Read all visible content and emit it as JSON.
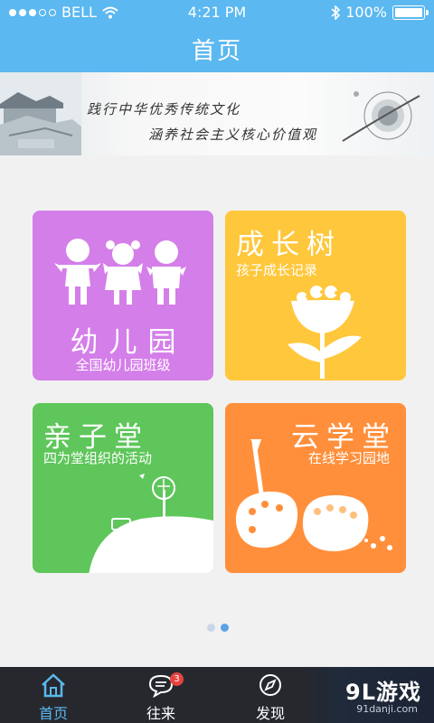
{
  "status": {
    "carrier": "BELL",
    "time": "4:21 PM",
    "battery": "100%"
  },
  "header": {
    "title": "首页"
  },
  "banner": {
    "line1": "践行中华优秀传统文化",
    "line2": "涵养社会主义核心价值观"
  },
  "tiles": [
    {
      "title": "幼儿园",
      "subtitle": "全国幼儿园班级",
      "color": "#d47ee9"
    },
    {
      "title": "成长树",
      "subtitle": "孩子成长记录",
      "color": "#ffc73b"
    },
    {
      "title": "亲子堂",
      "subtitle": "四为堂组织的活动",
      "color": "#5ec65a"
    },
    {
      "title": "云学堂",
      "subtitle": "在线学习园地",
      "color": "#ff8f3b"
    }
  ],
  "pager": {
    "pages": 2,
    "current": 2
  },
  "tabbar": {
    "items": [
      {
        "label": "首页",
        "icon": "home-icon",
        "active": true
      },
      {
        "label": "往来",
        "icon": "chat-icon",
        "badge": "3"
      },
      {
        "label": "发现",
        "icon": "compass-icon"
      }
    ]
  },
  "watermark": {
    "brand": "9L游戏",
    "domain": "91danji.com"
  },
  "colors": {
    "primary": "#5bb8f0",
    "tabbar_bg": "#27282d",
    "badge": "#e64340"
  }
}
